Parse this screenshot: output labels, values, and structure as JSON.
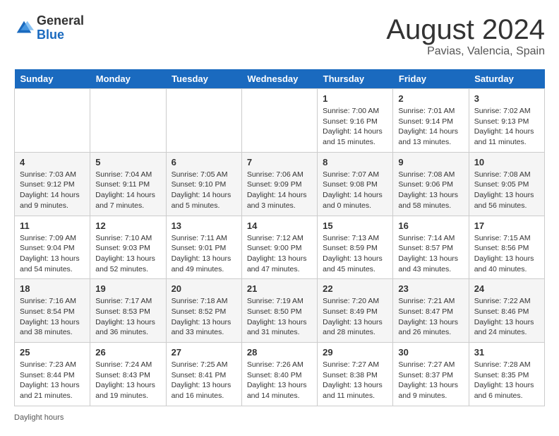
{
  "header": {
    "logo_general": "General",
    "logo_blue": "Blue",
    "month_year": "August 2024",
    "location": "Pavias, Valencia, Spain"
  },
  "days_of_week": [
    "Sunday",
    "Monday",
    "Tuesday",
    "Wednesday",
    "Thursday",
    "Friday",
    "Saturday"
  ],
  "weeks": [
    [
      {
        "day": "",
        "sunrise": "",
        "sunset": "",
        "daylight": ""
      },
      {
        "day": "",
        "sunrise": "",
        "sunset": "",
        "daylight": ""
      },
      {
        "day": "",
        "sunrise": "",
        "sunset": "",
        "daylight": ""
      },
      {
        "day": "",
        "sunrise": "",
        "sunset": "",
        "daylight": ""
      },
      {
        "day": "1",
        "sunrise": "7:00 AM",
        "sunset": "9:16 PM",
        "daylight": "14 hours and 15 minutes."
      },
      {
        "day": "2",
        "sunrise": "7:01 AM",
        "sunset": "9:14 PM",
        "daylight": "14 hours and 13 minutes."
      },
      {
        "day": "3",
        "sunrise": "7:02 AM",
        "sunset": "9:13 PM",
        "daylight": "14 hours and 11 minutes."
      }
    ],
    [
      {
        "day": "4",
        "sunrise": "7:03 AM",
        "sunset": "9:12 PM",
        "daylight": "14 hours and 9 minutes."
      },
      {
        "day": "5",
        "sunrise": "7:04 AM",
        "sunset": "9:11 PM",
        "daylight": "14 hours and 7 minutes."
      },
      {
        "day": "6",
        "sunrise": "7:05 AM",
        "sunset": "9:10 PM",
        "daylight": "14 hours and 5 minutes."
      },
      {
        "day": "7",
        "sunrise": "7:06 AM",
        "sunset": "9:09 PM",
        "daylight": "14 hours and 3 minutes."
      },
      {
        "day": "8",
        "sunrise": "7:07 AM",
        "sunset": "9:08 PM",
        "daylight": "14 hours and 0 minutes."
      },
      {
        "day": "9",
        "sunrise": "7:08 AM",
        "sunset": "9:06 PM",
        "daylight": "13 hours and 58 minutes."
      },
      {
        "day": "10",
        "sunrise": "7:08 AM",
        "sunset": "9:05 PM",
        "daylight": "13 hours and 56 minutes."
      }
    ],
    [
      {
        "day": "11",
        "sunrise": "7:09 AM",
        "sunset": "9:04 PM",
        "daylight": "13 hours and 54 minutes."
      },
      {
        "day": "12",
        "sunrise": "7:10 AM",
        "sunset": "9:03 PM",
        "daylight": "13 hours and 52 minutes."
      },
      {
        "day": "13",
        "sunrise": "7:11 AM",
        "sunset": "9:01 PM",
        "daylight": "13 hours and 49 minutes."
      },
      {
        "day": "14",
        "sunrise": "7:12 AM",
        "sunset": "9:00 PM",
        "daylight": "13 hours and 47 minutes."
      },
      {
        "day": "15",
        "sunrise": "7:13 AM",
        "sunset": "8:59 PM",
        "daylight": "13 hours and 45 minutes."
      },
      {
        "day": "16",
        "sunrise": "7:14 AM",
        "sunset": "8:57 PM",
        "daylight": "13 hours and 43 minutes."
      },
      {
        "day": "17",
        "sunrise": "7:15 AM",
        "sunset": "8:56 PM",
        "daylight": "13 hours and 40 minutes."
      }
    ],
    [
      {
        "day": "18",
        "sunrise": "7:16 AM",
        "sunset": "8:54 PM",
        "daylight": "13 hours and 38 minutes."
      },
      {
        "day": "19",
        "sunrise": "7:17 AM",
        "sunset": "8:53 PM",
        "daylight": "13 hours and 36 minutes."
      },
      {
        "day": "20",
        "sunrise": "7:18 AM",
        "sunset": "8:52 PM",
        "daylight": "13 hours and 33 minutes."
      },
      {
        "day": "21",
        "sunrise": "7:19 AM",
        "sunset": "8:50 PM",
        "daylight": "13 hours and 31 minutes."
      },
      {
        "day": "22",
        "sunrise": "7:20 AM",
        "sunset": "8:49 PM",
        "daylight": "13 hours and 28 minutes."
      },
      {
        "day": "23",
        "sunrise": "7:21 AM",
        "sunset": "8:47 PM",
        "daylight": "13 hours and 26 minutes."
      },
      {
        "day": "24",
        "sunrise": "7:22 AM",
        "sunset": "8:46 PM",
        "daylight": "13 hours and 24 minutes."
      }
    ],
    [
      {
        "day": "25",
        "sunrise": "7:23 AM",
        "sunset": "8:44 PM",
        "daylight": "13 hours and 21 minutes."
      },
      {
        "day": "26",
        "sunrise": "7:24 AM",
        "sunset": "8:43 PM",
        "daylight": "13 hours and 19 minutes."
      },
      {
        "day": "27",
        "sunrise": "7:25 AM",
        "sunset": "8:41 PM",
        "daylight": "13 hours and 16 minutes."
      },
      {
        "day": "28",
        "sunrise": "7:26 AM",
        "sunset": "8:40 PM",
        "daylight": "13 hours and 14 minutes."
      },
      {
        "day": "29",
        "sunrise": "7:27 AM",
        "sunset": "8:38 PM",
        "daylight": "13 hours and 11 minutes."
      },
      {
        "day": "30",
        "sunrise": "7:27 AM",
        "sunset": "8:37 PM",
        "daylight": "13 hours and 9 minutes."
      },
      {
        "day": "31",
        "sunrise": "7:28 AM",
        "sunset": "8:35 PM",
        "daylight": "13 hours and 6 minutes."
      }
    ]
  ],
  "footer": {
    "daylight_label": "Daylight hours"
  }
}
